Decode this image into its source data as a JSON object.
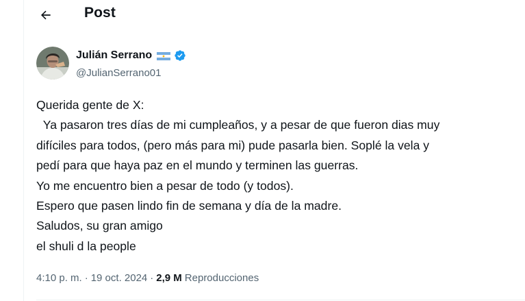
{
  "header": {
    "back_icon": "arrow-left-icon",
    "title": "Post"
  },
  "author": {
    "display_name": "Julián Serrano",
    "flag_icon": "argentina-flag-icon",
    "verified_icon": "verified-badge-icon",
    "handle": "@JulianSerrano01",
    "verified_color": "#1d9bf0"
  },
  "tweet": {
    "lines": [
      "Querida gente de X:",
      "  Ya pasaron tres días de mi cumpleaños, y a pesar de que fueron dias muy",
      "difíciles para todos, (pero más para mi) pude pasarla bien. Soplé la vela y",
      "pedí para que haya paz en el mundo y terminen las guerras.",
      "Yo me encuentro bien a pesar de todo (y todos).",
      "Espero que pasen lindo fin de semana y día de la madre.",
      "Saludos, su gran amigo",
      "el shuli d la people"
    ]
  },
  "meta": {
    "time": "4:10 p. m.",
    "separator": "·",
    "date": "19 oct. 2024",
    "views_count": "2,9 M",
    "views_label": "Reproducciones"
  }
}
